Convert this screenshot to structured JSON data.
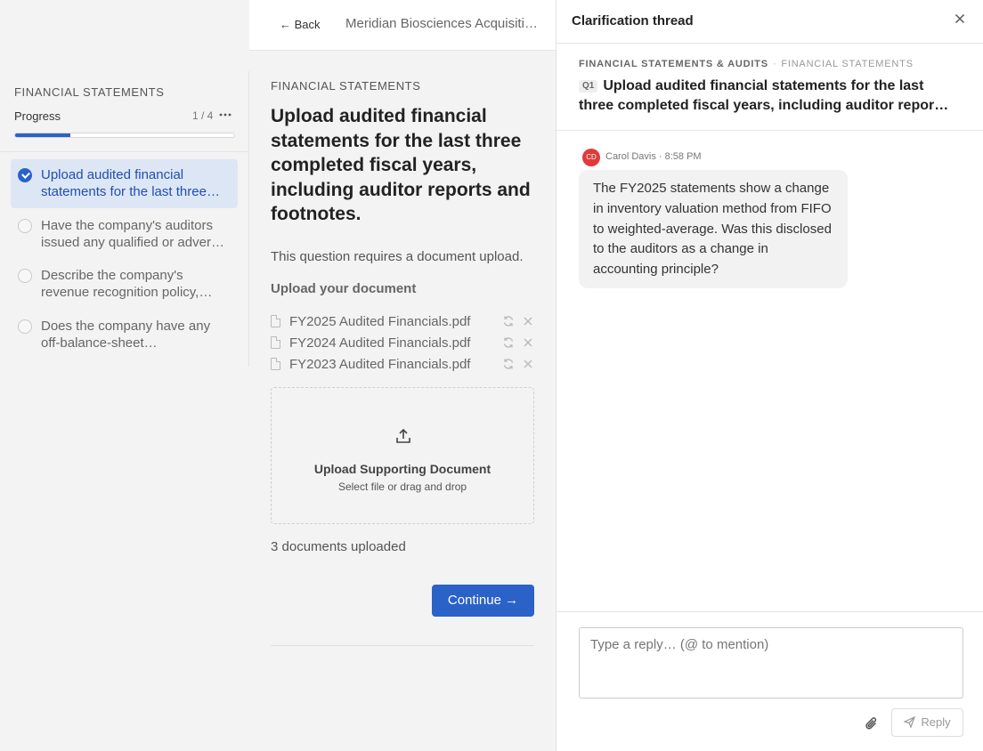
{
  "sidebar": {
    "section_title": "Financial Statements",
    "progress_label": "Progress",
    "progress_count": "1 / 4",
    "progress_fraction": 0.25,
    "questions": [
      {
        "text": "Upload audited financial statements for the last three completed fiscal years, including auditor reports and footnotes.",
        "active": true,
        "done": true
      },
      {
        "text": "Have the company's auditors issued any qualified or adverse opinions?",
        "active": false,
        "done": false
      },
      {
        "text": "Describe the company's revenue recognition policy, including any recent changes.",
        "active": false,
        "done": false
      },
      {
        "text": "Does the company have any off-balance-sheet arrangements?",
        "active": false,
        "done": false
      }
    ]
  },
  "main": {
    "back_label": "← Back",
    "breadcrumb": "Meridian Biosciences Acquisition",
    "section_label": "Financial Statements",
    "question_title": "Upload audited financial statements for the last three completed fiscal years, including auditor reports and footnotes.",
    "requirement_note": "This question requires a document upload.",
    "upload_label": "Upload your document",
    "files": [
      {
        "name": "FY2025 Audited Financials.pdf"
      },
      {
        "name": "FY2024 Audited Financials.pdf"
      },
      {
        "name": "FY2023 Audited Financials.pdf"
      }
    ],
    "dropzone_title": "Upload Supporting Document",
    "dropzone_sub": "Select file or drag and drop",
    "uploaded_count": "3 documents uploaded",
    "continue_label": "Continue →"
  },
  "thread": {
    "title": "Clarification thread",
    "crumb_category": "Financial Statements & Audits",
    "crumb_sep": "·",
    "crumb_section": "Financial Statements",
    "question_tag": "Q1",
    "question_text": "Upload audited financial statements for the last three completed fiscal years, including auditor reports and footnotes.",
    "message": {
      "author_initials": "CD",
      "meta": "Carol Davis · 8:58 PM",
      "body": "The FY2025 statements show a change in inventory valuation method from FIFO to weighted-average. Was this disclosed to the auditors as a change in accounting principle?"
    },
    "reply_placeholder": "Type a reply… (@ to mention)",
    "reply_label": "Reply"
  },
  "colors": {
    "accent": "#2b62c8",
    "active_bg": "#dde6f5",
    "avatar": "#e03a3a"
  }
}
